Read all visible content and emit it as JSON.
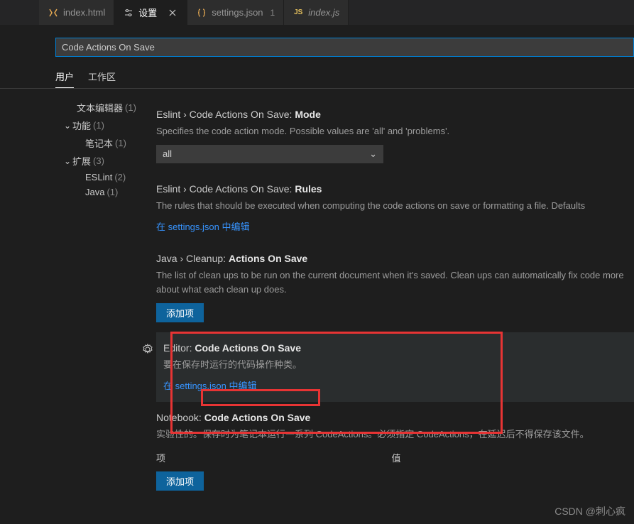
{
  "tabs": [
    {
      "icon": "html",
      "label": "index.html"
    },
    {
      "icon": "settings",
      "label": "设置",
      "active": true
    },
    {
      "icon": "json",
      "label": "settings.json",
      "modified": "1"
    },
    {
      "icon": "js",
      "label": "index.js",
      "italic": true
    }
  ],
  "search": {
    "value": "Code Actions On Save"
  },
  "subtabs": {
    "user": "用户",
    "workspace": "工作区"
  },
  "sidebar": {
    "textEditor": {
      "label": "文本编辑器",
      "count": "(1)"
    },
    "features": {
      "label": "功能",
      "count": "(1)"
    },
    "notebook": {
      "label": "笔记本",
      "count": "(1)"
    },
    "extensions": {
      "label": "扩展",
      "count": "(3)"
    },
    "eslint": {
      "label": "ESLint",
      "count": "(2)"
    },
    "java": {
      "label": "Java",
      "count": "(1)"
    }
  },
  "settings": {
    "eslintMode": {
      "breadcrumb": "Eslint › Code Actions On Save:",
      "name": "Mode",
      "desc": "Specifies the code action mode. Possible values are 'all' and 'problems'.",
      "value": "all"
    },
    "eslintRules": {
      "breadcrumb": "Eslint › Code Actions On Save:",
      "name": "Rules",
      "desc": "The rules that should be executed when computing the code actions on save or formatting a file. Defaults",
      "link": "在 settings.json 中编辑"
    },
    "javaCleanup": {
      "breadcrumb": "Java › Cleanup:",
      "name": "Actions On Save",
      "desc": "The list of clean ups to be run on the current document when it's saved. Clean ups can automatically fix code more about what each clean up does.",
      "button": "添加项"
    },
    "editorCodeActions": {
      "breadcrumb": "Editor:",
      "name": "Code Actions On Save",
      "desc": "要在保存时运行的代码操作种类。",
      "link": "在 settings.json 中编辑"
    },
    "notebookCodeActions": {
      "breadcrumb": "Notebook:",
      "name": "Code Actions On Save",
      "desc": "实验性的。保存时为笔记本运行一系列 CodeActions。必须指定 CodeActions，在延迟后不得保存该文件。",
      "colItem": "项",
      "colValue": "值",
      "button": "添加项"
    }
  },
  "watermark": "CSDN @刺心疯"
}
